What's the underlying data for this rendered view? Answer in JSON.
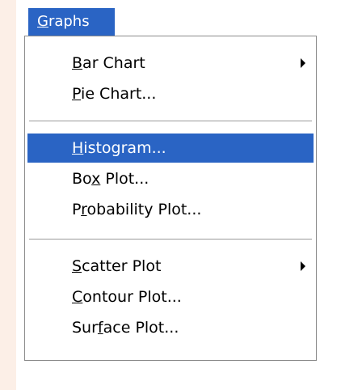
{
  "menu": {
    "title": {
      "accel": "G",
      "rest": "raphs"
    },
    "items": [
      {
        "pre": "",
        "accel": "B",
        "post": "ar Chart",
        "submenu": true,
        "selected": false
      },
      {
        "pre": "",
        "accel": "P",
        "post": "ie Chart...",
        "submenu": false,
        "selected": false
      },
      {
        "pre": "",
        "accel": "H",
        "post": "istogram...",
        "submenu": false,
        "selected": true
      },
      {
        "pre": "Bo",
        "accel": "x",
        "post": " Plot...",
        "submenu": false,
        "selected": false
      },
      {
        "pre": "P",
        "accel": "r",
        "post": "obability Plot...",
        "submenu": false,
        "selected": false
      },
      {
        "pre": "",
        "accel": "S",
        "post": "catter Plot",
        "submenu": true,
        "selected": false
      },
      {
        "pre": "",
        "accel": "C",
        "post": "ontour Plot...",
        "submenu": false,
        "selected": false
      },
      {
        "pre": "Sur",
        "accel": "f",
        "post": "ace Plot...",
        "submenu": false,
        "selected": false
      }
    ]
  },
  "colors": {
    "highlight": "#2a64c4",
    "highlight_text": "#ffffff",
    "left_strip": "#fcefe7",
    "border": "#8c8c8c"
  }
}
